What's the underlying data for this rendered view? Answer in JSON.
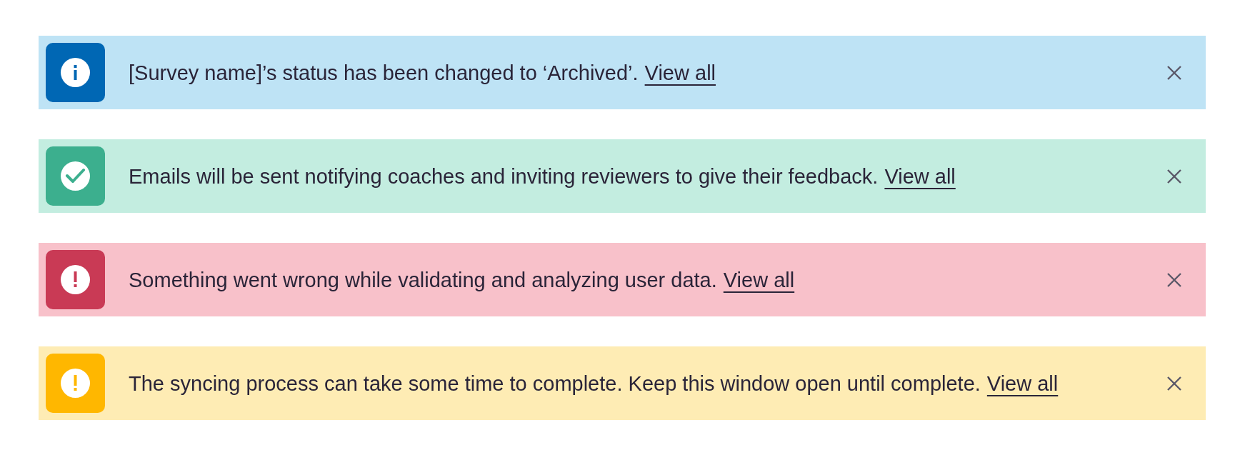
{
  "alerts": [
    {
      "kind": "info",
      "message": "[Survey name]’s status has been changed to ‘Archived’.",
      "link": "View all"
    },
    {
      "kind": "success",
      "message": "Emails will be sent notifying coaches and inviting reviewers to give their feedback.",
      "link": "View all"
    },
    {
      "kind": "error",
      "message": "Something went wrong while validating and analyzing user data.",
      "link": "View all"
    },
    {
      "kind": "warning",
      "message": "The syncing process can take some time to complete. Keep this window open until complete.",
      "link": "View all"
    }
  ]
}
